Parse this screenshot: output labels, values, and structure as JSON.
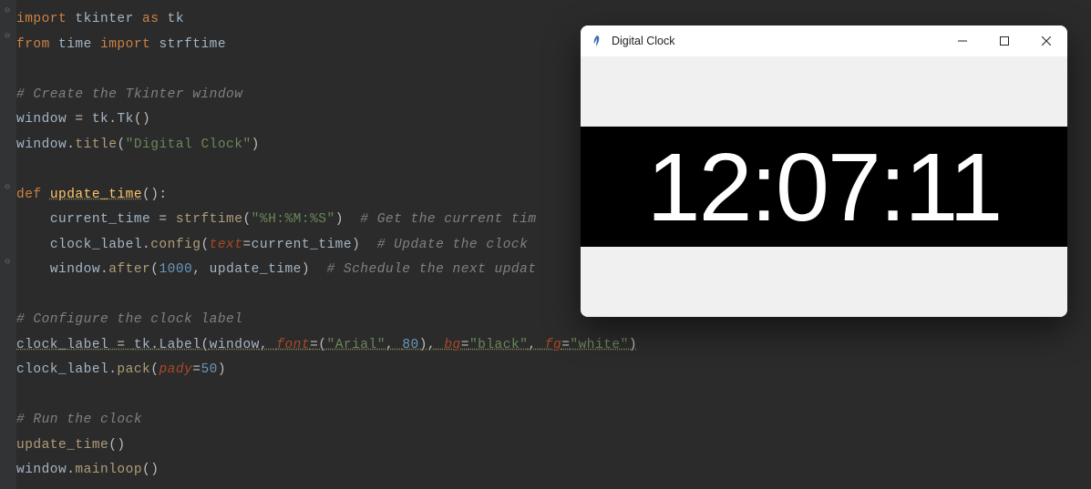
{
  "code": {
    "line1": {
      "import": "import",
      "mod": "tkinter",
      "as": "as",
      "alias": "tk"
    },
    "line2": {
      "from": "from",
      "mod": "time",
      "import": "import",
      "name": "strftime"
    },
    "line3": "",
    "line4": {
      "comment": "# Create the Tkinter window"
    },
    "line5": {
      "lhs": "window",
      "eq": " = ",
      "rhs1": "tk",
      "dot": ".",
      "rhs2": "Tk",
      "paren": "()"
    },
    "line6": {
      "obj": "window",
      "dot": ".",
      "method": "title",
      "open": "(",
      "arg": "\"Digital Clock\"",
      "close": ")"
    },
    "line7": "",
    "line8": {
      "def": "def",
      "name": "update_time",
      "paren": "():"
    },
    "line9": {
      "indent": "    ",
      "lhs": "current_time",
      "eq": " = ",
      "fn": "strftime",
      "open": "(",
      "arg": "\"%H:%M:%S\"",
      "close": ")",
      "comment": "  # Get the current tim"
    },
    "line10": {
      "indent": "    ",
      "obj": "clock_label",
      "dot": ".",
      "method": "config",
      "open": "(",
      "kw": "text",
      "eq": "=",
      "val": "current_time",
      "close": ")",
      "comment": "  # Update the clock "
    },
    "line11": {
      "indent": "    ",
      "obj": "window",
      "dot": ".",
      "method": "after",
      "open": "(",
      "n": "1000",
      "comma": ", ",
      "fn": "update_time",
      "close": ")",
      "comment": "  # Schedule the next updat"
    },
    "line12": "",
    "line13": {
      "comment": "# Configure the clock label"
    },
    "line14": {
      "lhs": "clock_label",
      "eq": " = ",
      "mod": "tk",
      "dot": ".",
      "cls": "Label",
      "open": "(",
      "a1": "window",
      "c1": ", ",
      "k1": "font",
      "e1": "=(",
      "s1": "\"Arial\"",
      "cm": ", ",
      "n1": "80",
      "cp": "), ",
      "k2": "bg",
      "e2": "=",
      "s2": "\"black\"",
      "c2": ", ",
      "k3": "fg",
      "e3": "=",
      "s3": "\"white\"",
      "close": ")"
    },
    "line15": {
      "obj": "clock_label",
      "dot": ".",
      "method": "pack",
      "open": "(",
      "kw": "pady",
      "eq": "=",
      "n": "50",
      "close": ")"
    },
    "line16": "",
    "line17": {
      "comment": "# Run the clock"
    },
    "line18": {
      "fn": "update_time",
      "paren": "()"
    },
    "line19": {
      "obj": "window",
      "dot": ".",
      "method": "mainloop",
      "paren": "()"
    }
  },
  "app": {
    "title": "Digital Clock",
    "clock_time": "12:07:11"
  },
  "colors": {
    "editor_bg": "#2b2b2b",
    "clock_bg": "#000000",
    "clock_fg": "#ffffff",
    "titlebar_bg": "#ffffff",
    "window_body": "#f0f0f0"
  }
}
